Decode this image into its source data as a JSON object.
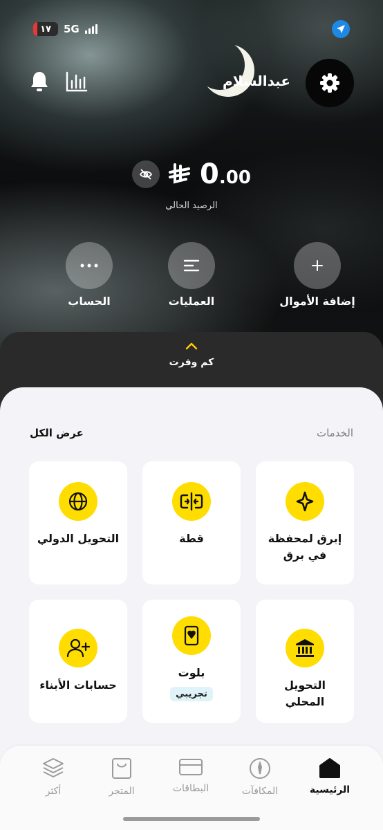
{
  "status_bar": {
    "battery": "١٧",
    "network": "5G"
  },
  "header": {
    "username": "عبدالسلام"
  },
  "balance": {
    "currency_symbol": "⃁",
    "amount_int": "0",
    "amount_dec": ".00",
    "label": "الرصيد الحالي"
  },
  "actions": [
    {
      "label": "إضافة الأموال",
      "icon": "plus-icon"
    },
    {
      "label": "العمليات",
      "icon": "list-icon"
    },
    {
      "label": "الحساب",
      "icon": "more-icon"
    }
  ],
  "savings": {
    "label": "كم وفرت"
  },
  "services": {
    "title": "الخدمات",
    "view_all": "عرض الكل",
    "items": [
      {
        "label": "إبرق لمحفظة في برق",
        "icon": "sparkle-icon"
      },
      {
        "label": "قطة",
        "icon": "split-icon"
      },
      {
        "label": "التحويل الدولي",
        "icon": "globe-icon"
      },
      {
        "label": "التحويل المحلي",
        "icon": "bank-icon"
      },
      {
        "label": "بلوت",
        "icon": "card-icon",
        "tag": "تجريبي"
      },
      {
        "label": "حسابات الأبناء",
        "icon": "add-user-icon"
      }
    ]
  },
  "tabs": [
    {
      "label": "الرئيسية",
      "icon": "home-icon",
      "active": true
    },
    {
      "label": "المكافآت",
      "icon": "compass-icon"
    },
    {
      "label": "البطاقات",
      "icon": "card-outline-icon"
    },
    {
      "label": "المتجر",
      "icon": "bag-icon"
    },
    {
      "label": "أكثر",
      "icon": "layers-icon"
    }
  ],
  "colors": {
    "accent": "#FFDD00",
    "hero_dark": "#0C0D0E",
    "panel": "#F4F4F8"
  }
}
